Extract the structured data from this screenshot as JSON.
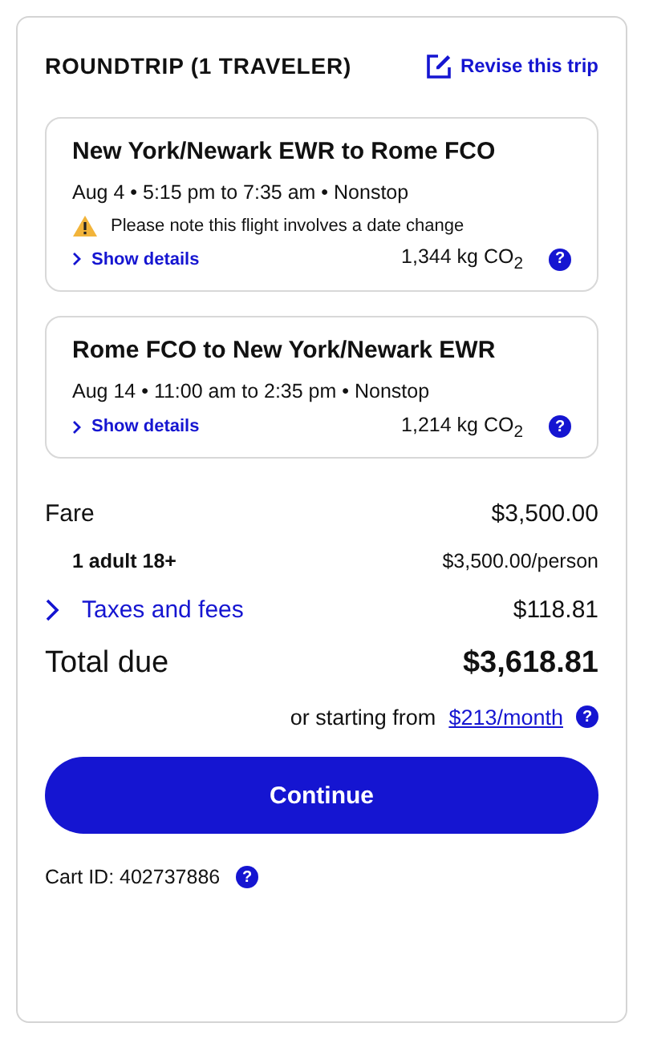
{
  "header": {
    "title": "ROUNDTRIP (1 TRAVELER)",
    "revise_link": "Revise this trip"
  },
  "flights": [
    {
      "route": "New York/Newark EWR to Rome FCO",
      "schedule": "Aug 4 • 5:15 pm to 7:35 am • Nonstop",
      "warning": "Please note this flight involves a date change",
      "details_link": "Show details",
      "emissions": "1,344 kg CO$_{2}$",
      "help": "?"
    },
    {
      "route": "Rome FCO to New York/Newark EWR",
      "schedule": "Aug 14 • 11:00 am to 2:35 pm • Nonstop",
      "details_link": "Show details",
      "emissions": "1,214 kg CO$_{2}$",
      "help": "?"
    }
  ],
  "price": {
    "fare_label": "Fare",
    "fare_value": "$3,500.00",
    "traveler_label": "1 adult 18+",
    "traveler_value": "$3,500.00/person",
    "taxes_label": "Taxes and fees",
    "taxes_value": "$118.81",
    "total_label": "Total due",
    "total_value": "$3,618.81",
    "installment_prefix": "or starting from",
    "installment_link": "$213/month",
    "installment_help": "?"
  },
  "continue_button": "Continue",
  "cart": {
    "label": "Cart ID: 402737886",
    "help": "?"
  }
}
